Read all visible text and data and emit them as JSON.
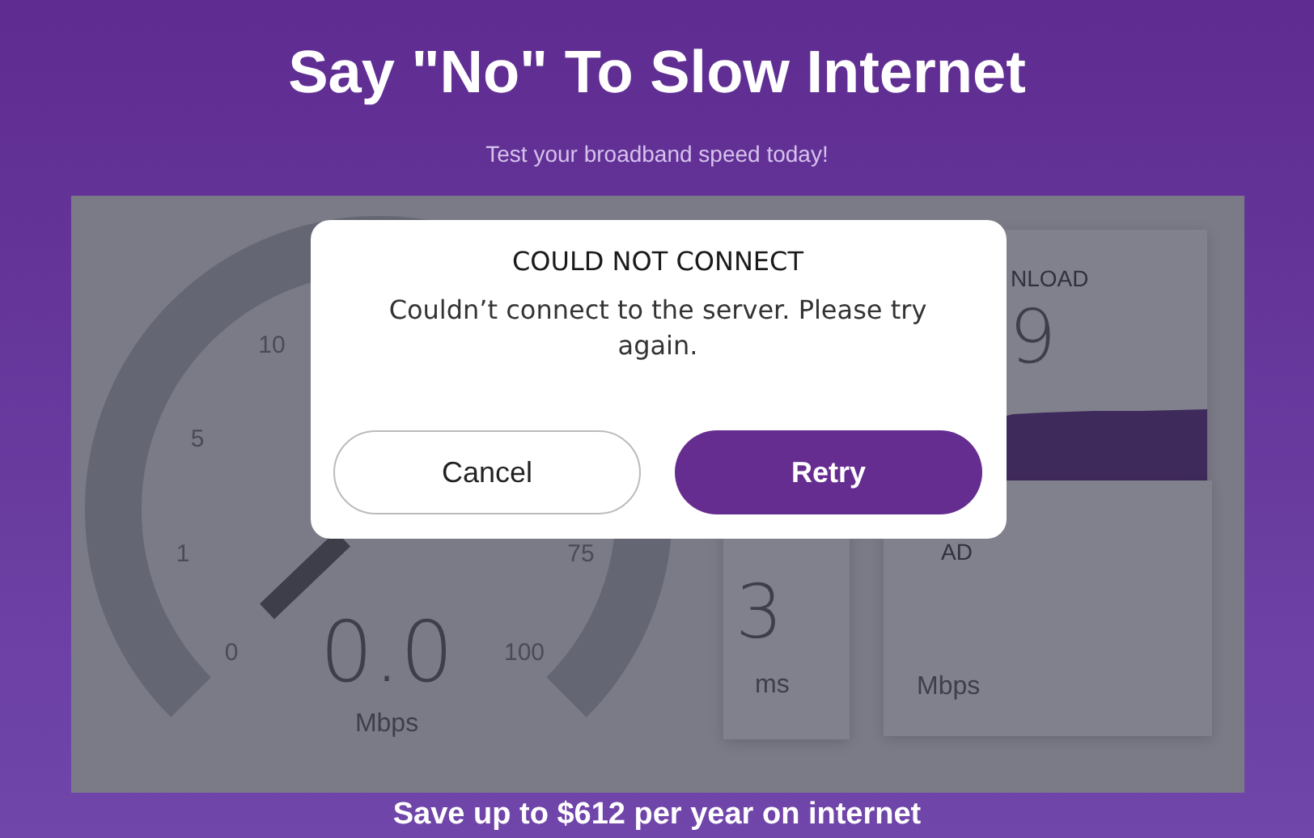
{
  "header": {
    "title": "Say \"No\" To Slow Internet",
    "subtitle": "Test your broadband speed today!"
  },
  "gauge": {
    "ticks": [
      "0",
      "1",
      "5",
      "10",
      "75",
      "100"
    ],
    "reading": "0.0",
    "unit": "Mbps"
  },
  "results": [
    {
      "kind": "download",
      "label": "NLOAD",
      "value": "9"
    },
    {
      "kind": "jitter",
      "value": "3",
      "unit": "ms"
    },
    {
      "kind": "upload",
      "label": "AD",
      "unit": "Mbps"
    }
  ],
  "dialog": {
    "title": "COULD NOT CONNECT",
    "message": "Couldn’t connect to the server. Please try again.",
    "buttons": [
      {
        "label": "Cancel",
        "kind": "secondary"
      },
      {
        "label": "Retry",
        "kind": "primary"
      }
    ]
  },
  "footer": "Save up to $612 per year on internet"
}
